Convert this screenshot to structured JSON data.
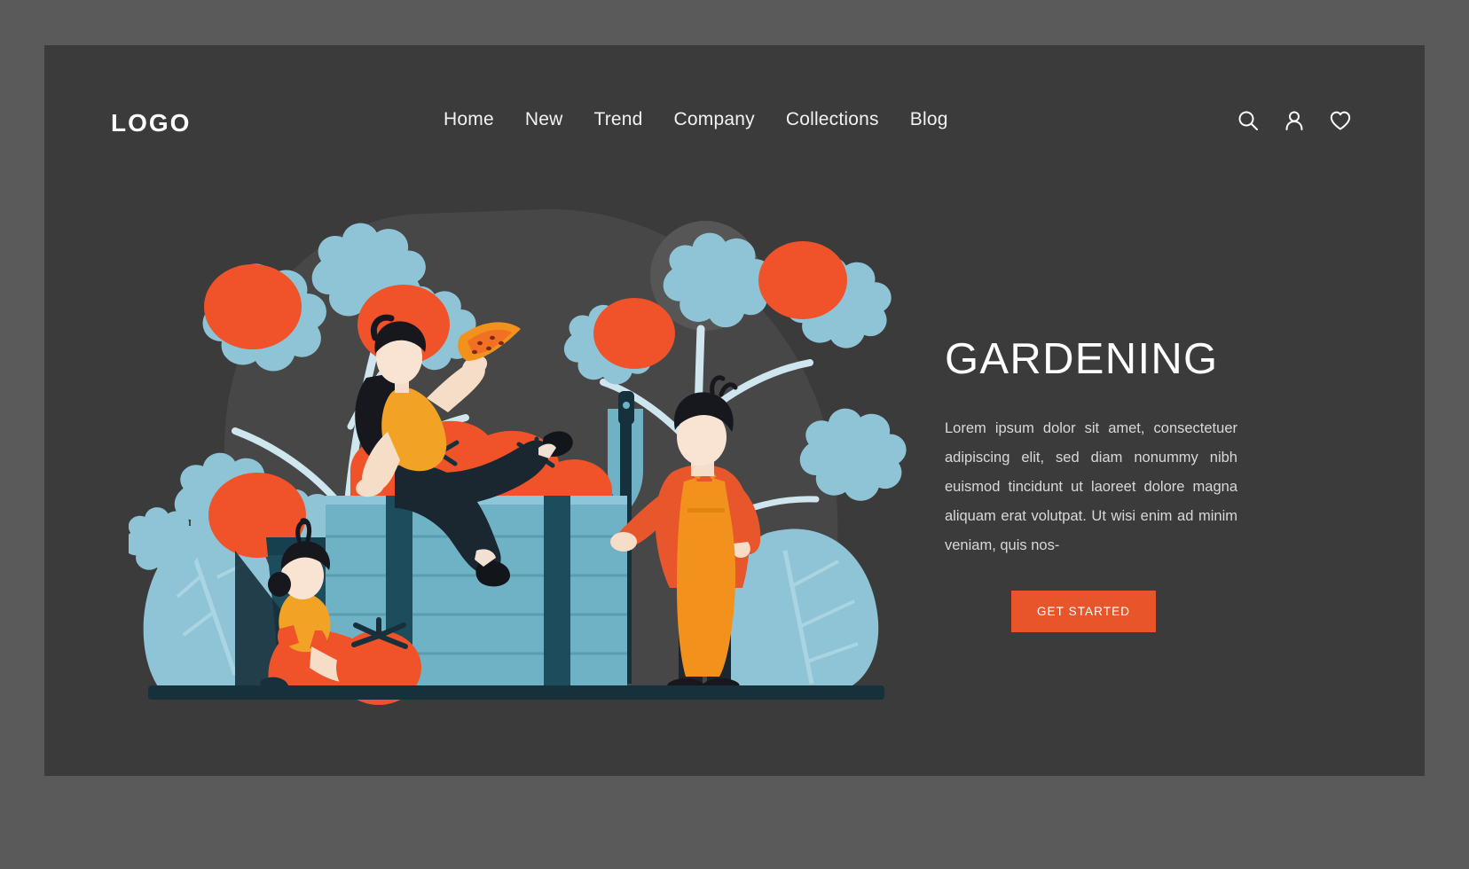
{
  "theme": {
    "page_background": "#5a5a5a",
    "card_background": "#3b3b3b",
    "accent_orange": "#e8552a",
    "tomato_orange": "#f05a28",
    "apron_orange": "#f2921d",
    "leaf_blue": "#8fc4d6",
    "crate_blue": "#6fb2c6",
    "crate_dark": "#1d4d5c",
    "dark_navy": "#16303c",
    "text_white": "#ffffff",
    "text_muted": "#d8d8d8",
    "blob_gray": "#4a4a4a",
    "circle_gray": "#555555"
  },
  "header": {
    "logo": "LOGO",
    "nav": [
      {
        "label": "Home"
      },
      {
        "label": "New"
      },
      {
        "label": "Trend"
      },
      {
        "label": "Company"
      },
      {
        "label": "Collections"
      },
      {
        "label": "Blog"
      }
    ],
    "icons": [
      {
        "name": "search-icon",
        "glyph": "search"
      },
      {
        "name": "user-icon",
        "glyph": "user"
      },
      {
        "name": "heart-icon",
        "glyph": "heart"
      }
    ]
  },
  "hero": {
    "title": "GARDENING",
    "body": "Lorem ipsum dolor sit amet, consectetuer adipiscing elit, sed diam nonummy nibh euismod tincidunt ut laoreet dolore magna aliquam erat volutpat. Ut wisi enim ad minim veniam, quis nos-",
    "cta_label": "GET STARTED"
  },
  "illustration": {
    "alt": "gardening-scene",
    "elements": [
      "background-blob",
      "background-circle",
      "tomato-plant-left",
      "tomato-plant-right",
      "planter-pot",
      "leaf-left",
      "leaf-right",
      "wooden-crate",
      "tomatoes-in-crate",
      "woman-sitting-on-crate",
      "girl-with-tomato",
      "man-with-shovel",
      "ground-line"
    ]
  }
}
